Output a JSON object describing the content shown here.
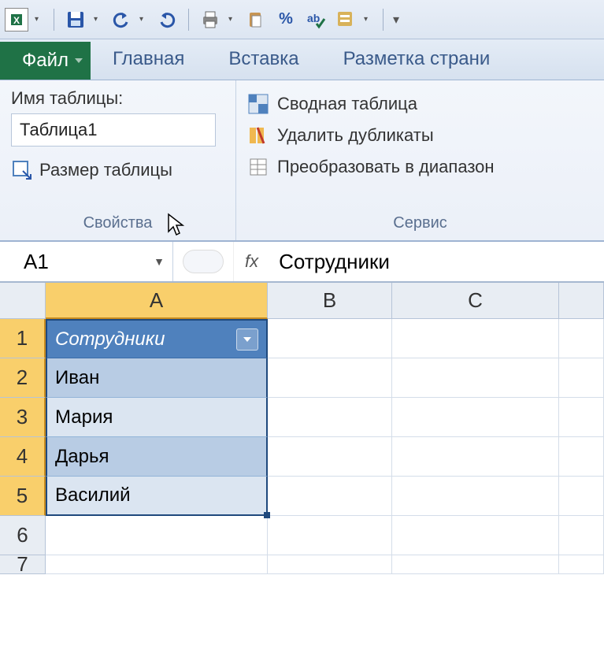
{
  "qat": {
    "icons": [
      "save-icon",
      "undo-icon",
      "redo-icon",
      "print-icon",
      "copy-icon",
      "percent-icon",
      "spellcheck-icon",
      "tools-icon"
    ]
  },
  "tabs": {
    "file": "Файл",
    "home": "Главная",
    "insert": "Вставка",
    "layout": "Разметка страни"
  },
  "ribbon": {
    "properties": {
      "title": "Имя таблицы:",
      "table_name": "Таблица1",
      "resize": "Размер таблицы",
      "group_label": "Свойства"
    },
    "tools": {
      "pivot": "Сводная таблица",
      "dedupe": "Удалить дубликаты",
      "convert": "Преобразовать в диапазон",
      "group_label": "Сервис"
    }
  },
  "formula_bar": {
    "namebox": "A1",
    "fx": "fx",
    "value": "Сотрудники"
  },
  "columns": [
    "A",
    "B",
    "C",
    ""
  ],
  "rows": [
    "1",
    "2",
    "3",
    "4",
    "5",
    "6",
    "7"
  ],
  "table": {
    "header": "Сотрудники",
    "data": [
      "Иван",
      "Мария",
      "Дарья",
      "Василий"
    ]
  }
}
